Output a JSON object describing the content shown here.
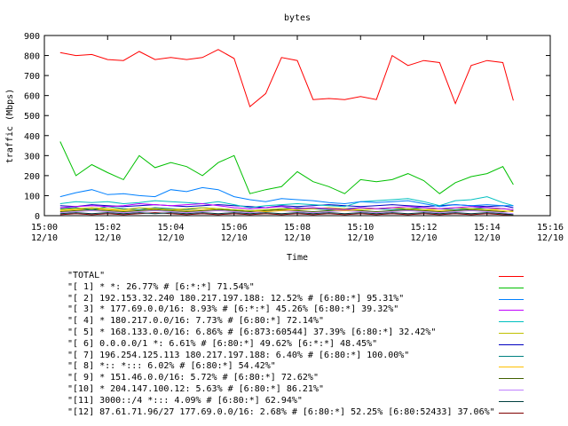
{
  "chart_data": {
    "type": "line",
    "title": "bytes",
    "xlabel": "Time",
    "ylabel": "traffic (Mbps)",
    "ylim": [
      0,
      900
    ],
    "yticks": [
      0,
      100,
      200,
      300,
      400,
      500,
      600,
      700,
      800,
      900
    ],
    "xlim": [
      "15:00",
      "15:16"
    ],
    "xticks": [
      {
        "time": "15:00",
        "date": "12/10"
      },
      {
        "time": "15:02",
        "date": "12/10"
      },
      {
        "time": "15:04",
        "date": "12/10"
      },
      {
        "time": "15:06",
        "date": "12/10"
      },
      {
        "time": "15:08",
        "date": "12/10"
      },
      {
        "time": "15:10",
        "date": "12/10"
      },
      {
        "time": "15:12",
        "date": "12/10"
      },
      {
        "time": "15:14",
        "date": "12/10"
      },
      {
        "time": "15:16",
        "date": "12/10"
      }
    ],
    "grid": false,
    "legend_placement": "bottom",
    "x": [
      "15:00:30",
      "15:01:00",
      "15:01:30",
      "15:02:00",
      "15:02:30",
      "15:03:00",
      "15:03:30",
      "15:04:00",
      "15:04:30",
      "15:05:00",
      "15:05:30",
      "15:06:00",
      "15:06:30",
      "15:07:00",
      "15:07:30",
      "15:08:00",
      "15:08:30",
      "15:09:00",
      "15:09:30",
      "15:10:00",
      "15:10:30",
      "15:11:00",
      "15:11:30",
      "15:12:00",
      "15:12:30",
      "15:13:00",
      "15:13:30",
      "15:14:00",
      "15:14:30",
      "15:14:50"
    ],
    "series": [
      {
        "name": "\"TOTAL\"",
        "color": "#ff0000",
        "values": [
          815,
          800,
          805,
          780,
          775,
          820,
          780,
          790,
          780,
          790,
          830,
          785,
          545,
          610,
          790,
          775,
          580,
          585,
          580,
          595,
          580,
          800,
          750,
          775,
          765,
          560,
          750,
          775,
          765,
          575
        ]
      },
      {
        "name": "\"[ 1] * *: 26.77% # [6:*:*] 71.54%\"",
        "color": "#00c000",
        "values": [
          370,
          200,
          255,
          215,
          180,
          300,
          240,
          265,
          245,
          200,
          265,
          300,
          110,
          130,
          145,
          220,
          170,
          145,
          110,
          180,
          170,
          180,
          210,
          175,
          110,
          165,
          195,
          210,
          245,
          155
        ]
      },
      {
        "name": "\"[ 2] 192.153.32.240 180.217.197.188: 12.52% # [6:80:*] 95.31%\"",
        "color": "#0080ff",
        "values": [
          95,
          115,
          130,
          105,
          110,
          100,
          95,
          130,
          120,
          140,
          130,
          95,
          80,
          70,
          85,
          80,
          75,
          65,
          60,
          70,
          65,
          70,
          75,
          60,
          45,
          55,
          50,
          55,
          50,
          50
        ]
      },
      {
        "name": "\"[ 3] * 177.69.0.0/16: 8.93% # [6:*:*] 45.26% [6:80:*] 39.32%\"",
        "color": "#c000ff",
        "values": [
          40,
          45,
          50,
          45,
          50,
          60,
          55,
          50,
          55,
          60,
          50,
          40,
          35,
          40,
          45,
          35,
          40,
          35,
          30,
          40,
          35,
          40,
          45,
          40,
          35,
          40,
          45,
          40,
          35,
          30
        ]
      },
      {
        "name": "\"[ 4] * 180.217.0.0/16: 7.73% # [6:80:*] 72.14%\"",
        "color": "#00c0c0",
        "values": [
          60,
          70,
          65,
          70,
          60,
          65,
          75,
          70,
          65,
          60,
          70,
          55,
          40,
          50,
          55,
          60,
          55,
          50,
          45,
          70,
          75,
          80,
          85,
          70,
          50,
          75,
          80,
          95,
          65,
          50
        ]
      },
      {
        "name": "\"[ 5] * 168.133.0.0/16: 6.86% # [6:873:60544] 37.39% [6:80:*] 32.42%\"",
        "color": "#c0c000",
        "values": [
          30,
          35,
          40,
          35,
          30,
          40,
          35,
          30,
          35,
          40,
          35,
          30,
          25,
          30,
          35,
          30,
          35,
          40,
          35,
          30,
          35,
          40,
          35,
          30,
          35,
          40,
          35,
          30,
          35,
          30
        ]
      },
      {
        "name": "\"[ 6] 0.0.0.0/1 *: 6.61% # [6:80:*] 49.62% [6:*:*] 48.45%\"",
        "color": "#0000c0",
        "values": [
          50,
          45,
          55,
          50,
          45,
          50,
          55,
          50,
          45,
          50,
          55,
          50,
          45,
          40,
          50,
          45,
          50,
          55,
          50,
          45,
          50,
          55,
          50,
          45,
          50,
          55,
          50,
          45,
          50,
          40
        ]
      },
      {
        "name": "\"[ 7] 196.254.125.113 180.217.197.188: 6.40% # [6:80:*] 100.00%\"",
        "color": "#008080",
        "values": [
          35,
          40,
          30,
          45,
          35,
          30,
          40,
          35,
          30,
          40,
          35,
          30,
          25,
          30,
          35,
          40,
          35,
          30,
          35,
          40,
          35,
          30,
          35,
          40,
          35,
          30,
          35,
          40,
          35,
          30
        ]
      },
      {
        "name": "\"[ 8] *:: *::: 6.02% # [6:80:*] 54.42%\"",
        "color": "#ffc000",
        "values": [
          25,
          30,
          35,
          30,
          25,
          30,
          35,
          30,
          25,
          30,
          35,
          30,
          25,
          20,
          25,
          30,
          35,
          30,
          25,
          30,
          35,
          40,
          35,
          30,
          25,
          30,
          35,
          30,
          25,
          20
        ]
      },
      {
        "name": "\"[ 9] * 151.46.0.0/16: 5.72% # [6:80:*] 72.62%\"",
        "color": "#406000",
        "values": [
          20,
          25,
          30,
          25,
          20,
          25,
          30,
          25,
          20,
          25,
          30,
          25,
          20,
          25,
          30,
          25,
          20,
          25,
          30,
          25,
          20,
          25,
          30,
          25,
          20,
          25,
          30,
          25,
          20,
          25
        ]
      },
      {
        "name": "\"[10] * 204.147.100.12: 5.63% # [6:80:*] 86.21%\"",
        "color": "#c080ff",
        "values": [
          15,
          20,
          25,
          20,
          15,
          20,
          25,
          20,
          15,
          20,
          25,
          20,
          15,
          20,
          25,
          20,
          15,
          20,
          25,
          20,
          15,
          20,
          25,
          20,
          15,
          20,
          25,
          20,
          15,
          10
        ]
      },
      {
        "name": "\"[11] 3000::/4 *::: 4.09% # [6:80:*] 62.94%\"",
        "color": "#004040",
        "values": [
          10,
          15,
          10,
          15,
          10,
          15,
          10,
          15,
          10,
          15,
          10,
          15,
          10,
          15,
          10,
          15,
          10,
          15,
          10,
          15,
          10,
          15,
          10,
          15,
          10,
          15,
          10,
          15,
          10,
          5
        ]
      },
      {
        "name": "\"[12] 87.61.71.96/27 177.69.0.0/16: 2.68% # [6:80:*] 52.25% [6:80:52433] 37.06%\"",
        "color": "#800000",
        "values": [
          5,
          10,
          5,
          10,
          5,
          10,
          15,
          10,
          5,
          10,
          5,
          10,
          5,
          10,
          5,
          10,
          5,
          10,
          5,
          10,
          5,
          10,
          5,
          10,
          5,
          10,
          5,
          10,
          5,
          5
        ]
      }
    ]
  }
}
